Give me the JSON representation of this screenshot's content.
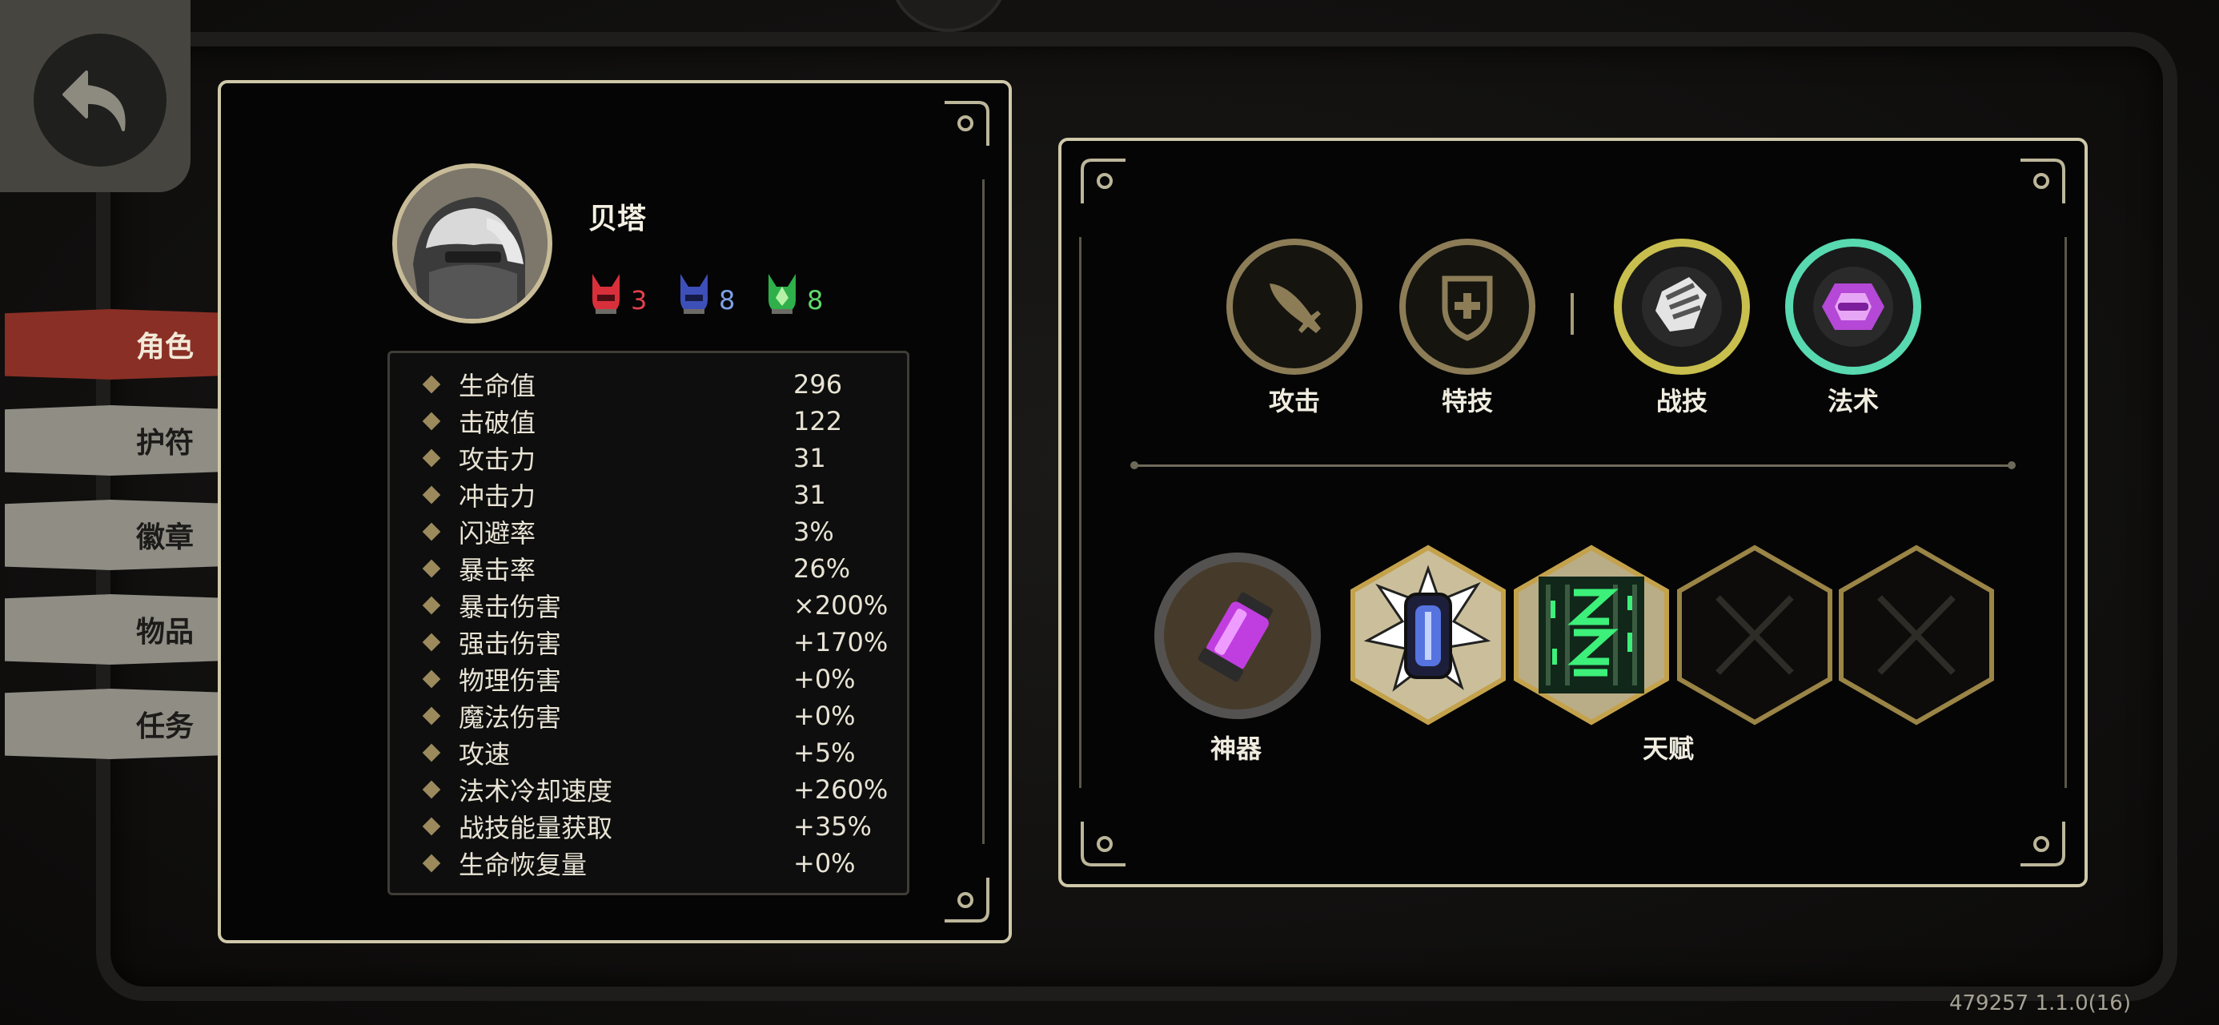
{
  "nav": {
    "back_icon": "back-arrow-icon",
    "tabs": [
      {
        "label": "角色",
        "active": true
      },
      {
        "label": "护符",
        "active": false
      },
      {
        "label": "徽章",
        "active": false
      },
      {
        "label": "物品",
        "active": false
      },
      {
        "label": "任务",
        "active": false
      }
    ]
  },
  "character": {
    "name": "贝塔",
    "portrait_icon": "armored-knight-portrait",
    "resources": [
      {
        "icon": "red-mask-icon",
        "value": "3",
        "color": "#e3414c"
      },
      {
        "icon": "blue-mask-icon",
        "value": "8",
        "color": "#7fa0e6"
      },
      {
        "icon": "green-mask-icon",
        "value": "8",
        "color": "#5fd96a"
      }
    ]
  },
  "stats": [
    {
      "label": "生命值",
      "value": "296"
    },
    {
      "label": "击破值",
      "value": "122"
    },
    {
      "label": "攻击力",
      "value": "31"
    },
    {
      "label": "冲击力",
      "value": "31"
    },
    {
      "label": "闪避率",
      "value": "3%"
    },
    {
      "label": "暴击率",
      "value": "26%"
    },
    {
      "label": "暴击伤害",
      "value": "×200%"
    },
    {
      "label": "强击伤害",
      "value": "+170%"
    },
    {
      "label": "物理伤害",
      "value": "+0%"
    },
    {
      "label": "魔法伤害",
      "value": "+0%"
    },
    {
      "label": "攻速",
      "value": "+5%"
    },
    {
      "label": "法术冷却速度",
      "value": "+260%"
    },
    {
      "label": "战技能量获取",
      "value": "+35%"
    },
    {
      "label": "生命恢复量",
      "value": "+0%"
    }
  ],
  "skills": [
    {
      "label": "攻击",
      "icon": "sword-icon",
      "ring": "#8c7d57"
    },
    {
      "label": "特技",
      "icon": "shield-plus-icon",
      "ring": "#8c7d57"
    },
    {
      "label": "战技",
      "icon": "gauntlet-icon",
      "ring": "#c8bf4e"
    },
    {
      "label": "法术",
      "icon": "purple-gem-icon",
      "ring": "#58d9b0"
    }
  ],
  "equipment": {
    "artifact_label": "神器",
    "artifact_icon": "purple-canister-icon",
    "talent_label": "天赋",
    "talents": [
      {
        "icon": "blue-capsule-burst-icon",
        "empty": false
      },
      {
        "icon": "green-rune-icon",
        "empty": false
      },
      {
        "icon": "empty-slot-x-icon",
        "empty": true
      },
      {
        "icon": "empty-slot-x-icon",
        "empty": true
      }
    ]
  },
  "version": "479257 1.1.0(16)"
}
